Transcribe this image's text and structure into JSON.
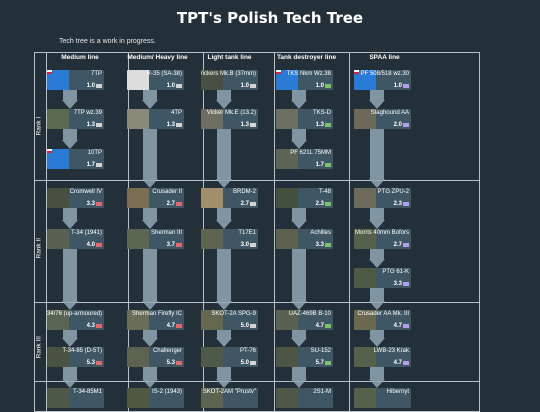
{
  "title": "TPT's Polish Tech Tree",
  "note": "Tech tree is a work in progress.",
  "columns": [
    "Medium line",
    "Medium/ Heavy line",
    "Light tank line",
    "Tank destroyer line",
    "SPAA line"
  ],
  "ranks": [
    "Rank I",
    "Rank II",
    "Rank III"
  ],
  "colors": {
    "background": "#243039",
    "card": "#3f5664",
    "arrow": "#8fa7b4",
    "border": "#b8c0c6"
  },
  "cards": [
    {
      "id": "7tp",
      "name": "7TP",
      "br": "1.0",
      "col": 0,
      "row": 0,
      "thumb": "#2a7bd6",
      "flag": true,
      "type": "light"
    },
    {
      "id": "7tp39",
      "name": "7TP wz.39",
      "br": "1.3",
      "col": 0,
      "row": 1,
      "thumb": "#5a6a50",
      "flag": false,
      "type": "light"
    },
    {
      "id": "10tp",
      "name": "10TP",
      "br": "1.7",
      "col": 0,
      "row": 2,
      "thumb": "#2a7bd6",
      "flag": true,
      "type": "light"
    },
    {
      "id": "r35",
      "name": "R-35 (SA-38)",
      "br": "1.0",
      "col": 1,
      "row": 0,
      "thumb": "#dcdcdc",
      "flag": false,
      "type": "light"
    },
    {
      "id": "4tp",
      "name": "4TP",
      "br": "1.3",
      "col": 1,
      "row": 1,
      "thumb": "#8a8a7a",
      "flag": false,
      "type": "light"
    },
    {
      "id": "vickersb",
      "name": "Vickers Mk.B (37mm)",
      "br": "1.0",
      "col": 2,
      "row": 0,
      "thumb": "#4a4f44",
      "flag": false,
      "type": "light"
    },
    {
      "id": "vickerse",
      "name": "Vicker Mk.E (13.2)",
      "br": "1.3",
      "col": 2,
      "row": 1,
      "thumb": "#6b6e60",
      "flag": false,
      "type": "light"
    },
    {
      "id": "tks38",
      "name": "TKS Nkm Wz.38",
      "br": "1.0",
      "col": 3,
      "row": 0,
      "thumb": "#2a7bd6",
      "flag": true,
      "type": "td"
    },
    {
      "id": "tksd",
      "name": "TKS-D",
      "br": "1.3",
      "col": 3,
      "row": 1,
      "thumb": "#6c7060",
      "flag": false,
      "type": "td"
    },
    {
      "id": "pf621",
      "name": "PF 621L 75MM",
      "br": "1.7",
      "col": 3,
      "row": 2,
      "thumb": "#5d6456",
      "flag": false,
      "type": "td"
    },
    {
      "id": "pf508",
      "name": "PF 508/518 wz.30",
      "br": "1.0",
      "col": 4,
      "row": 0,
      "thumb": "#2a7bd6",
      "flag": true,
      "type": "spaa"
    },
    {
      "id": "staghound",
      "name": "Staghound AA",
      "br": "2.0",
      "col": 4,
      "row": 1,
      "thumb": "#6b6a5a",
      "flag": false,
      "type": "spaa"
    },
    {
      "id": "cromwell",
      "name": "Cromwell IV",
      "br": "3.3",
      "col": 0,
      "row": 3,
      "thumb": "#4a5040",
      "flag": false,
      "type": "medium"
    },
    {
      "id": "t34",
      "name": "T-34 (1941)",
      "br": "4.0",
      "col": 0,
      "row": 4,
      "thumb": "#5b6150",
      "flag": false,
      "type": "medium"
    },
    {
      "id": "crusader2",
      "name": "Crusader II",
      "br": "2.7",
      "col": 1,
      "row": 3,
      "thumb": "#7a6e52",
      "flag": false,
      "type": "medium"
    },
    {
      "id": "sherman3",
      "name": "Sherman III",
      "br": "3.7",
      "col": 1,
      "row": 4,
      "thumb": "#5d6653",
      "flag": false,
      "type": "medium"
    },
    {
      "id": "brdm2",
      "name": "BRDM-2",
      "br": "2.7",
      "col": 2,
      "row": 3,
      "thumb": "#a08f6a",
      "flag": false,
      "type": "light"
    },
    {
      "id": "t17e1",
      "name": "T17E1",
      "br": "3.0",
      "col": 2,
      "row": 4,
      "thumb": "#5e6450",
      "flag": false,
      "type": "light"
    },
    {
      "id": "t48",
      "name": "T-48",
      "br": "2.3",
      "col": 3,
      "row": 3,
      "thumb": "#44503e",
      "flag": false,
      "type": "td"
    },
    {
      "id": "achilles",
      "name": "Achilles",
      "br": "3.3",
      "col": 3,
      "row": 4,
      "thumb": "#5c6150",
      "flag": false,
      "type": "td"
    },
    {
      "id": "zpu2",
      "name": "PTG ZPU-2",
      "br": "2.3",
      "col": 4,
      "row": 3,
      "thumb": "#6c6a5a",
      "flag": false,
      "type": "spaa"
    },
    {
      "id": "morris",
      "name": "Morris 40mm Bofors",
      "br": "2.7",
      "col": 4,
      "row": 4,
      "thumb": "#55604a",
      "flag": false,
      "type": "spaa"
    },
    {
      "id": "ptg61k",
      "name": "PTG 61-K",
      "br": "3.3",
      "col": 4,
      "row": 5,
      "thumb": "#4e5a46",
      "flag": false,
      "type": "spaa"
    },
    {
      "id": "t3476",
      "name": "T-34/76 (up-armoured)",
      "br": "4.3",
      "col": 0,
      "row": 6,
      "thumb": "#5b6453",
      "flag": false,
      "type": "medium"
    },
    {
      "id": "t3485",
      "name": "T-34-85 (D-5T)",
      "br": "5.3",
      "col": 0,
      "row": 7,
      "thumb": "#4a5242",
      "flag": false,
      "type": "medium"
    },
    {
      "id": "firefly",
      "name": "Sherman Firefly IC",
      "br": "4.7",
      "col": 1,
      "row": 6,
      "thumb": "#6a6e58",
      "flag": false,
      "type": "medium"
    },
    {
      "id": "challenger",
      "name": "Challenger",
      "br": "5.3",
      "col": 1,
      "row": 7,
      "thumb": "#5e6250",
      "flag": false,
      "type": "medium"
    },
    {
      "id": "skot2a",
      "name": "SKOT-2A SPG-9",
      "br": "5.0",
      "col": 2,
      "row": 6,
      "thumb": "#63684f",
      "flag": false,
      "type": "light"
    },
    {
      "id": "pt76",
      "name": "PT-76",
      "br": "5.0",
      "col": 2,
      "row": 7,
      "thumb": "#4e5a47",
      "flag": false,
      "type": "light"
    },
    {
      "id": "uaz",
      "name": "UAZ-469B B-10",
      "br": "4.7",
      "col": 3,
      "row": 6,
      "thumb": "#5a6152",
      "flag": false,
      "type": "td"
    },
    {
      "id": "su152",
      "name": "SU-152",
      "br": "5.7",
      "col": 3,
      "row": 7,
      "thumb": "#4d5644",
      "flag": false,
      "type": "td"
    },
    {
      "id": "crusaderaa",
      "name": "Crusader AA Mk. III",
      "br": "4.7",
      "col": 4,
      "row": 6,
      "thumb": "#6b6852",
      "flag": false,
      "type": "spaa"
    },
    {
      "id": "lwb23",
      "name": "LWB-23 Krak",
      "br": "4.7",
      "col": 4,
      "row": 7,
      "thumb": "#57604b",
      "flag": false,
      "type": "spaa"
    },
    {
      "id": "t3485m1",
      "name": "T-34-85M1",
      "br": "",
      "col": 0,
      "row": 8,
      "thumb": "#4f5746",
      "flag": false,
      "type": "medium"
    },
    {
      "id": "is2",
      "name": "IS-2 (1943)",
      "br": "",
      "col": 1,
      "row": 8,
      "thumb": "#50583f",
      "flag": false,
      "type": "heavy"
    },
    {
      "id": "skot2am",
      "name": "SKOT-2AM \"Prustv\"",
      "br": "",
      "col": 2,
      "row": 8,
      "thumb": "#5c6350",
      "flag": false,
      "type": "light"
    },
    {
      "id": "2s1m",
      "name": "2S1-M",
      "br": "",
      "col": 3,
      "row": 8,
      "thumb": "#4f5746",
      "flag": false,
      "type": "td"
    },
    {
      "id": "hibernyt",
      "name": "Hibernyt",
      "br": "",
      "col": 4,
      "row": 8,
      "thumb": "#56604b",
      "flag": false,
      "type": "spaa"
    }
  ]
}
